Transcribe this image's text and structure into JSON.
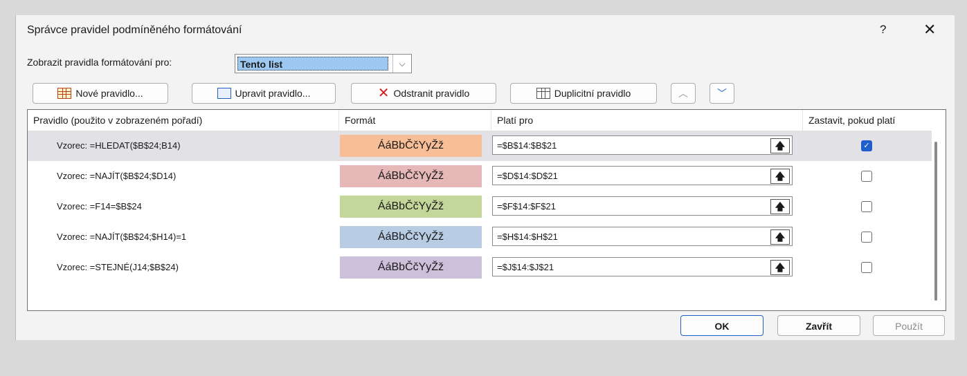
{
  "dialog": {
    "title": "Správce pravidel podmíněného formátování",
    "help": "?",
    "close": "✕"
  },
  "show": {
    "label": "Zobrazit pravidla formátování pro:",
    "selected": "Tento list",
    "arrow": "⌵"
  },
  "toolbar": {
    "new_rule": "Nové pravidlo...",
    "edit_rule": "Upravit pravidlo...",
    "delete_rule": "Odstranit pravidlo",
    "duplicate_rule": "Duplicitní pravidlo",
    "move_up": "︿",
    "move_down": "﹀"
  },
  "columns": {
    "rule": "Pravidlo (použito v zobrazeném pořadí)",
    "format": "Formát",
    "applies": "Platí pro",
    "stop": "Zastavit, pokud platí"
  },
  "rules": [
    {
      "rule": "Vzorec: =HLEDAT($B$24;B14)",
      "preview": "ÁáBbČčYyŽž",
      "color": "#f8be97",
      "range": "=$B$14:$B$21",
      "stop": true
    },
    {
      "rule": "Vzorec: =NAJÍT($B$24;$D14)",
      "preview": "ÁáBbČčYyŽž",
      "color": "#e6b8b7",
      "range": "=$D$14:$D$21",
      "stop": false
    },
    {
      "rule": "Vzorec: =F14=$B$24",
      "preview": "ÁáBbČčYyŽž",
      "color": "#c4d79b",
      "range": "=$F$14:$F$21",
      "stop": false
    },
    {
      "rule": "Vzorec: =NAJÍT($B$24;$H14)=1",
      "preview": "ÁáBbČčYyŽž",
      "color": "#b8cce4",
      "range": "=$H$14:$H$21",
      "stop": false
    },
    {
      "rule": "Vzorec: =STEJNÉ(J14;$B$24)",
      "preview": "ÁáBbČčYyŽž",
      "color": "#ccc0da",
      "range": "=$J$14:$J$21",
      "stop": false
    }
  ],
  "footer": {
    "ok": "OK",
    "close": "Zavřít",
    "apply": "Použít"
  },
  "icons": {
    "collapse": "🡅",
    "checkmark": "✓"
  }
}
